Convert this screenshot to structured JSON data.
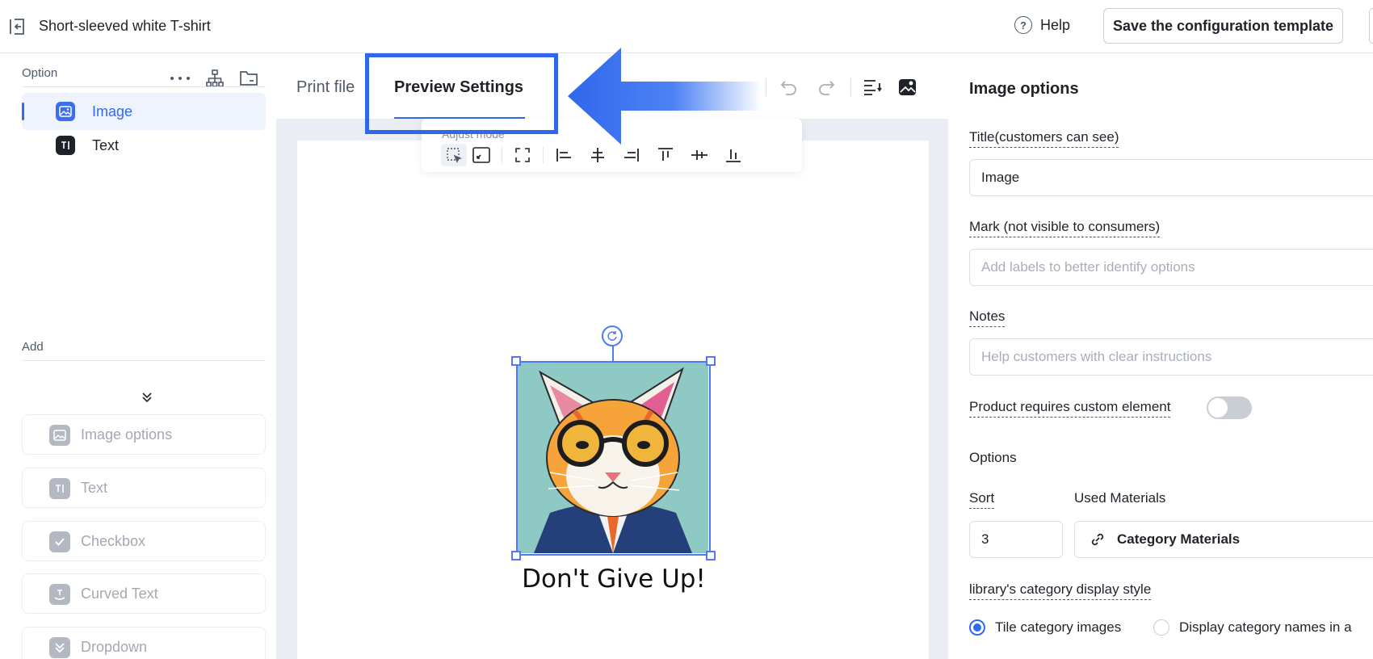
{
  "header": {
    "title": "Short-sleeved white T-shirt",
    "help_label": "Help",
    "save_label": "Save the configuration template"
  },
  "left_panel": {
    "option_label": "Option",
    "options": [
      {
        "label": "Image",
        "icon": "image-icon",
        "active": true
      },
      {
        "label": "Text",
        "icon": "text-icon",
        "active": false
      }
    ],
    "add_label": "Add",
    "add_items": [
      {
        "label": "Image options",
        "icon": "image-icon"
      },
      {
        "label": "Text",
        "icon": "text-icon"
      },
      {
        "label": "Checkbox",
        "icon": "checkbox-icon"
      },
      {
        "label": "Curved Text",
        "icon": "curved-text-icon"
      },
      {
        "label": "Dropdown",
        "icon": "dropdown-icon"
      }
    ]
  },
  "center": {
    "tabs": [
      {
        "label": "Print file",
        "active": false
      },
      {
        "label": "Preview Settings",
        "active": true
      }
    ],
    "toolbar_label": "Adjust mode",
    "canvas_caption": "Don't Give Up!",
    "highlight_color": "#2f67ec"
  },
  "right_panel": {
    "title": "Image options",
    "title_label": "Title(customers can see)",
    "title_value": "Image",
    "mark_label": "Mark (not visible to consumers)",
    "mark_placeholder": "Add labels to better identify options",
    "notes_label": "Notes",
    "notes_placeholder": "Help customers with clear instructions",
    "custom_element_label": "Product requires custom element",
    "custom_element_enabled": false,
    "options_label": "Options",
    "sort_label": "Sort",
    "sort_value": "3",
    "used_materials_label": "Used Materials",
    "category_materials_label": "Category Materials",
    "display_style_label": "library's category display style",
    "display_styles": [
      {
        "label": "Tile category images",
        "selected": true
      },
      {
        "label": "Display category names in a",
        "selected": false
      }
    ]
  },
  "colors": {
    "accent": "#2f6bec",
    "active_bg": "#eef3fe",
    "canvas_bg": "#eaedf3"
  }
}
